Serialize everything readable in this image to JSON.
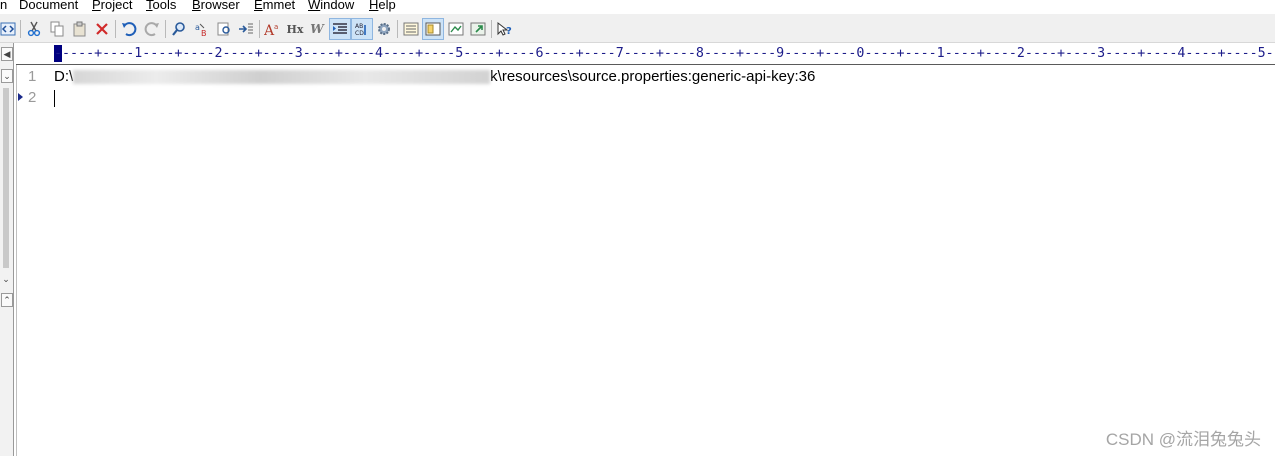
{
  "menu": {
    "items": [
      {
        "prefix": "",
        "accel": "",
        "rest": "n"
      },
      {
        "prefix": "",
        "accel": "",
        "rest": "Document"
      },
      {
        "prefix": "",
        "accel": "P",
        "rest": "roject"
      },
      {
        "prefix": "",
        "accel": "T",
        "rest": "ools"
      },
      {
        "prefix": "",
        "accel": "B",
        "rest": "rowser"
      },
      {
        "prefix": "",
        "accel": "E",
        "rest": "mmet"
      },
      {
        "prefix": "",
        "accel": "W",
        "rest": "indow"
      },
      {
        "prefix": "",
        "accel": "H",
        "rest": "elp"
      }
    ]
  },
  "toolbar": {
    "buttons": [
      {
        "icon": "code-view-icon"
      },
      {
        "icon": "cut-icon"
      },
      {
        "icon": "copy-icon"
      },
      {
        "icon": "paste-icon"
      },
      {
        "icon": "delete-icon"
      },
      {
        "icon": "undo-icon"
      },
      {
        "icon": "redo-icon"
      },
      {
        "icon": "find-icon"
      },
      {
        "icon": "replace-icon"
      },
      {
        "icon": "find-in-files-icon"
      },
      {
        "icon": "goto-line-icon"
      },
      {
        "icon": "font-size-icon"
      },
      {
        "icon": "html-heading-icon",
        "label": "Hx"
      },
      {
        "icon": "word-wrap-icon",
        "label": "W"
      },
      {
        "icon": "indent-icon",
        "active": true
      },
      {
        "icon": "spell-check-icon",
        "active": true
      },
      {
        "icon": "settings-gear-icon"
      },
      {
        "icon": "document-list-icon"
      },
      {
        "icon": "output-panel-icon",
        "active": true
      },
      {
        "icon": "preview-icon"
      },
      {
        "icon": "browser-preview-icon"
      },
      {
        "icon": "help-icon"
      }
    ]
  },
  "ruler": {
    "text": "-----+----1----+----2----+----3----+----4----+----5----+----6----+----7----+----8----+----9----+----0----+----1----+----2----+----3----+----4----+----5----"
  },
  "editor": {
    "lines": [
      {
        "number": "1",
        "path_start": "D:\\",
        "path_end": "k\\resources\\source.properties:generic-api-key:36"
      },
      {
        "number": "2",
        "text": ""
      }
    ]
  },
  "watermark": "CSDN @流泪兔兔头"
}
